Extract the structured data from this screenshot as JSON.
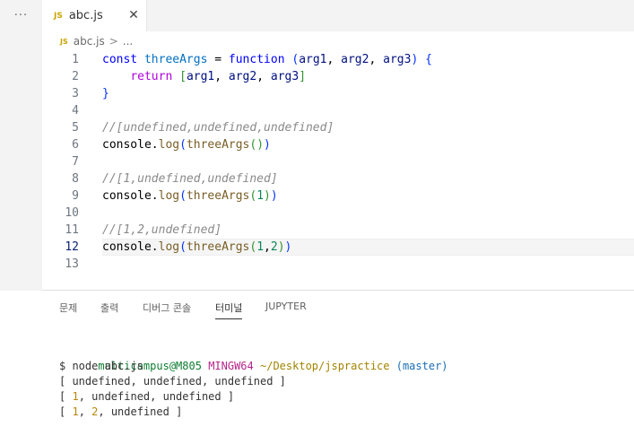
{
  "tabbar": {
    "more_label": "···",
    "file_tab": {
      "badge": "JS",
      "label": "abc.js",
      "close": "✕"
    }
  },
  "breadcrumb": {
    "badge": "JS",
    "file": "abc.js",
    "separator": ">",
    "more": "..."
  },
  "editor": {
    "line_numbers": [
      "1",
      "2",
      "3",
      "4",
      "5",
      "6",
      "7",
      "8",
      "9",
      "10",
      "11",
      "12",
      "13"
    ],
    "current_line": 12,
    "lines": [
      {
        "tokens": [
          {
            "t": "const ",
            "c": "kw"
          },
          {
            "t": "threeArgs",
            "c": "var"
          },
          {
            "t": " = ",
            "c": "obj"
          },
          {
            "t": "function",
            "c": "kw"
          },
          {
            "t": " (",
            "c": "b1"
          },
          {
            "t": "arg1",
            "c": "prm"
          },
          {
            "t": ", ",
            "c": "obj"
          },
          {
            "t": "arg2",
            "c": "prm"
          },
          {
            "t": ", ",
            "c": "obj"
          },
          {
            "t": "arg3",
            "c": "prm"
          },
          {
            "t": ")",
            "c": "b1"
          },
          {
            "t": " ",
            "c": "obj"
          },
          {
            "t": "{",
            "c": "b1"
          }
        ]
      },
      {
        "tokens": [
          {
            "t": "    ",
            "c": "obj"
          },
          {
            "t": "return",
            "c": "ctl"
          },
          {
            "t": " ",
            "c": "obj"
          },
          {
            "t": "[",
            "c": "b2"
          },
          {
            "t": "arg1",
            "c": "prm"
          },
          {
            "t": ", ",
            "c": "obj"
          },
          {
            "t": "arg2",
            "c": "prm"
          },
          {
            "t": ", ",
            "c": "obj"
          },
          {
            "t": "arg3",
            "c": "prm"
          },
          {
            "t": "]",
            "c": "b2"
          }
        ]
      },
      {
        "tokens": [
          {
            "t": "}",
            "c": "b1"
          }
        ]
      },
      {
        "tokens": []
      },
      {
        "tokens": [
          {
            "t": "//[undefined,undefined,undefined]",
            "c": "cmt"
          }
        ]
      },
      {
        "tokens": [
          {
            "t": "console",
            "c": "obj"
          },
          {
            "t": ".",
            "c": "obj"
          },
          {
            "t": "log",
            "c": "fn"
          },
          {
            "t": "(",
            "c": "b1"
          },
          {
            "t": "threeArgs",
            "c": "fn"
          },
          {
            "t": "()",
            "c": "b2"
          },
          {
            "t": ")",
            "c": "b1"
          }
        ]
      },
      {
        "tokens": []
      },
      {
        "tokens": [
          {
            "t": "//[1,undefined,undefined]",
            "c": "cmt"
          }
        ]
      },
      {
        "tokens": [
          {
            "t": "console",
            "c": "obj"
          },
          {
            "t": ".",
            "c": "obj"
          },
          {
            "t": "log",
            "c": "fn"
          },
          {
            "t": "(",
            "c": "b1"
          },
          {
            "t": "threeArgs",
            "c": "fn"
          },
          {
            "t": "(",
            "c": "b2"
          },
          {
            "t": "1",
            "c": "num"
          },
          {
            "t": ")",
            "c": "b2"
          },
          {
            "t": ")",
            "c": "b1"
          }
        ]
      },
      {
        "tokens": []
      },
      {
        "tokens": [
          {
            "t": "//[1,2,undefined]",
            "c": "cmt"
          }
        ]
      },
      {
        "tokens": [
          {
            "t": "console",
            "c": "obj"
          },
          {
            "t": ".",
            "c": "obj"
          },
          {
            "t": "log",
            "c": "fn"
          },
          {
            "t": "(",
            "c": "b1"
          },
          {
            "t": "threeArgs",
            "c": "fn"
          },
          {
            "t": "(",
            "c": "b2"
          },
          {
            "t": "1",
            "c": "num"
          },
          {
            "t": ",",
            "c": "obj"
          },
          {
            "t": "2",
            "c": "num"
          },
          {
            "t": ")",
            "c": "b2"
          },
          {
            "t": ")",
            "c": "b1"
          }
        ]
      },
      {
        "tokens": []
      }
    ]
  },
  "panel": {
    "tabs": [
      {
        "label": "문제",
        "active": false
      },
      {
        "label": "출력",
        "active": false
      },
      {
        "label": "디버그 콘솔",
        "active": false
      },
      {
        "label": "터미널",
        "active": true
      },
      {
        "label": "JUPYTER",
        "active": false
      }
    ],
    "terminal": {
      "prompt": {
        "user": "multicampus@M805",
        "msys": "MINGW64",
        "path": "~/Desktop/jspractice",
        "branch": "(master)"
      },
      "lines": [
        [
          {
            "t": "$ node abc.js",
            "c": ""
          }
        ],
        [
          {
            "t": "[ undefined, undefined, undefined ]",
            "c": ""
          }
        ],
        [
          {
            "t": "[ ",
            "c": ""
          },
          {
            "t": "1",
            "c": "t-num"
          },
          {
            "t": ", undefined, undefined ]",
            "c": ""
          }
        ],
        [
          {
            "t": "[ ",
            "c": ""
          },
          {
            "t": "1",
            "c": "t-num"
          },
          {
            "t": ", ",
            "c": ""
          },
          {
            "t": "2",
            "c": "t-num"
          },
          {
            "t": ", undefined ]",
            "c": ""
          }
        ]
      ]
    }
  },
  "colors": {
    "background": "#ffffff",
    "chrome": "#f3f3f3",
    "keyword": "#0000ff",
    "function": "#795e26",
    "comment": "#8a8a8a",
    "number": "#098658",
    "terminal_user": "#0d7d32",
    "terminal_path": "#a18400"
  }
}
